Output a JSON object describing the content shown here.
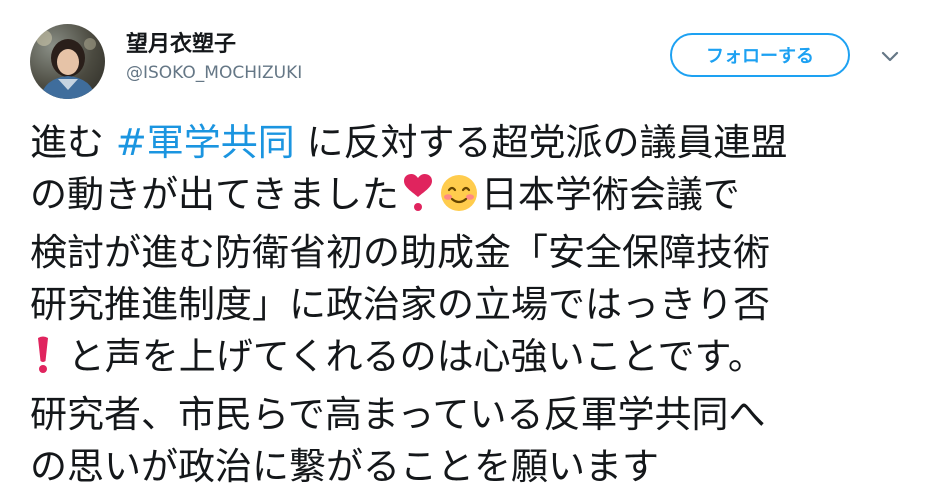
{
  "user": {
    "display_name": "望月衣塑子",
    "handle": "@ISOKO_MOCHIZUKI"
  },
  "actions": {
    "follow_label": "フォローする",
    "more_icon": "chevron-down-icon"
  },
  "tweet": {
    "line1_a": "進む ",
    "hashtag": "#軍学共同",
    "line1_b": " に反対する超党派の議員連盟",
    "line2_a": "の動きが出てきました",
    "heart_emoji_icon": "red-heart-exclamation-icon",
    "smile_emoji_icon": "smiling-face-icon",
    "line2_b": "日本学術会議で",
    "line3": "検討が進む防衛省初の助成金「安全保障技術",
    "line4": "研究推進制度」に政治家の立場ではっきり否",
    "exclamation_emoji_icon": "red-exclamation-icon",
    "line5": " と声を上げてくれるのは心強いことです。",
    "line6": "研究者、市民らで高まっている反軍学共同へ",
    "line7": "の思いが政治に繋がることを願います"
  },
  "colors": {
    "accent": "#1da1f2",
    "hashtag": "#1b95e0",
    "handle": "#657786",
    "text": "#14171a",
    "emoji_red": "#e0245e",
    "emoji_face": "#ffcc4d"
  }
}
